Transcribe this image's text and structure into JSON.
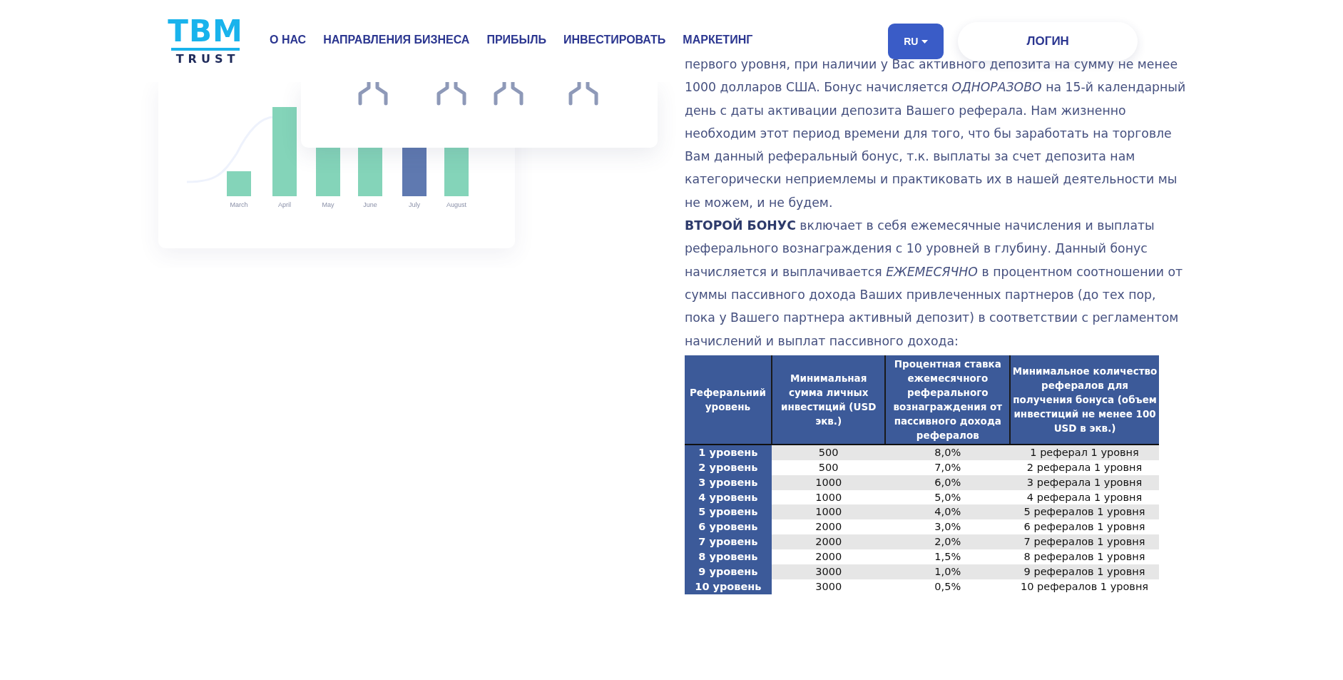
{
  "header": {
    "logo": {
      "title": "TBM",
      "subtitle": "TRUST"
    },
    "nav": [
      {
        "label": "О НАС"
      },
      {
        "label": "НАПРАВЛЕНИЯ БИЗНЕСА"
      },
      {
        "label": "ПРИБЫЛЬ"
      },
      {
        "label": "ИНВЕСТИРОВАТЬ"
      },
      {
        "label": "МАРКЕТИНГ"
      }
    ],
    "language": "RU",
    "login": "ЛОГИН"
  },
  "chart": {
    "months": [
      {
        "label": "March",
        "selected": false
      },
      {
        "label": "April",
        "selected": false
      },
      {
        "label": "May",
        "selected": false
      },
      {
        "label": "June",
        "selected": false
      },
      {
        "label": "July",
        "selected": true
      },
      {
        "label": "August",
        "selected": false
      }
    ]
  },
  "paragraphs": [
    "первого уровня, при наличии у Вас активного депозита на сумму не менее 1000 долларов США. Бонус начисляется *ОДНОРАЗОВО* на 15-й календарный день с даты активации депозита Вашего реферала. Нам жизненно необходим этот период времени для того, что бы заработать на торговле Вам данный реферальный бонус, т.к. выплаты за счет депозита нам категорически неприемлемы и практиковать их в нашей деятельности мы не можем, и не будем.",
    "**ВТОРОЙ БОНУС** включает в себя ежемесячные начисления и выплаты реферального вознаграждения с 10 уровней в глубину. Данный бонус начисляется и выплачивается *ЕЖЕМЕСЯЧНО* в процентном соотношении от суммы пассивного дохода Ваших привлеченных партнеров (до тех пор, пока у Вашего партнера активный депозит) в соответствии с регламентом начислений и выплат пассивного дохода:"
  ],
  "table": {
    "columns": [
      "Реферальний уровень",
      "Минимальная сумма личных инвестиций (USD экв.)",
      "Процентная ставка ежемесячного реферального вознаграждения от пассивного дохода рефералов",
      "Минимальное количество рефералов для получения бонуса (объем инвестиций не менее 100 USD в экв.)"
    ],
    "rows": [
      [
        "1 уровень",
        "500",
        "8,0%",
        "1 реферал 1 уровня"
      ],
      [
        "2 уровень",
        "500",
        "7,0%",
        "2 реферала 1 уровня"
      ],
      [
        "3 уровень",
        "1000",
        "6,0%",
        "3 реферала 1 уровня"
      ],
      [
        "4 уровень",
        "1000",
        "5,0%",
        "4 реферала 1 уровня"
      ],
      [
        "5 уровень",
        "1000",
        "4,0%",
        "5 рефералов 1 уровня"
      ],
      [
        "6 уровень",
        "2000",
        "3,0%",
        "6 рефералов 1 уровня"
      ],
      [
        "7 уровень",
        "2000",
        "2,0%",
        "7 рефералов 1 уровня"
      ],
      [
        "8 уровень",
        "2000",
        "1,5%",
        "8 рефералов 1 уровня"
      ],
      [
        "9 уровень",
        "3000",
        "1,0%",
        "9 рефералов 1 уровня"
      ],
      [
        "10 уровень",
        "3000",
        "0,5%",
        "10 рефералов 1 уровня"
      ]
    ]
  }
}
